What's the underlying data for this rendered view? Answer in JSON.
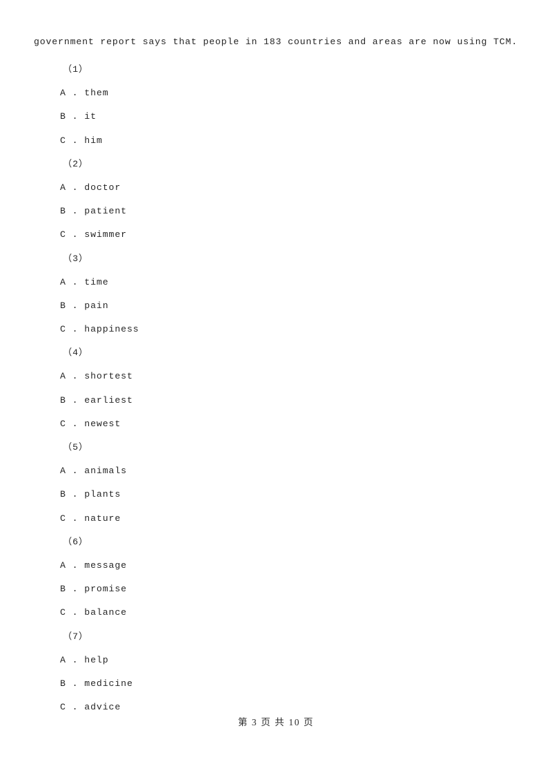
{
  "page": {
    "passage_fragment": "government report says that people in 183 countries and areas are now using TCM.",
    "footer": "第 3 页 共 10 页"
  },
  "questions": [
    {
      "number": "（1）",
      "options": [
        {
          "letter": "A .",
          "text": "them"
        },
        {
          "letter": "B .",
          "text": "it"
        },
        {
          "letter": "C .",
          "text": "him"
        }
      ]
    },
    {
      "number": "（2）",
      "options": [
        {
          "letter": "A .",
          "text": "doctor"
        },
        {
          "letter": "B .",
          "text": "patient"
        },
        {
          "letter": "C .",
          "text": "swimmer"
        }
      ]
    },
    {
      "number": "（3）",
      "options": [
        {
          "letter": "A .",
          "text": "time"
        },
        {
          "letter": "B .",
          "text": "pain"
        },
        {
          "letter": "C .",
          "text": "happiness"
        }
      ]
    },
    {
      "number": "（4）",
      "options": [
        {
          "letter": "A .",
          "text": "shortest"
        },
        {
          "letter": "B .",
          "text": "earliest"
        },
        {
          "letter": "C .",
          "text": "newest"
        }
      ]
    },
    {
      "number": "（5）",
      "options": [
        {
          "letter": "A .",
          "text": "animals"
        },
        {
          "letter": "B .",
          "text": "plants"
        },
        {
          "letter": "C .",
          "text": "nature"
        }
      ]
    },
    {
      "number": "（6）",
      "options": [
        {
          "letter": "A .",
          "text": "message"
        },
        {
          "letter": "B .",
          "text": "promise"
        },
        {
          "letter": "C .",
          "text": "balance"
        }
      ]
    },
    {
      "number": "（7）",
      "options": [
        {
          "letter": "A .",
          "text": "help"
        },
        {
          "letter": "B .",
          "text": "medicine"
        },
        {
          "letter": "C .",
          "text": "advice"
        }
      ]
    }
  ]
}
